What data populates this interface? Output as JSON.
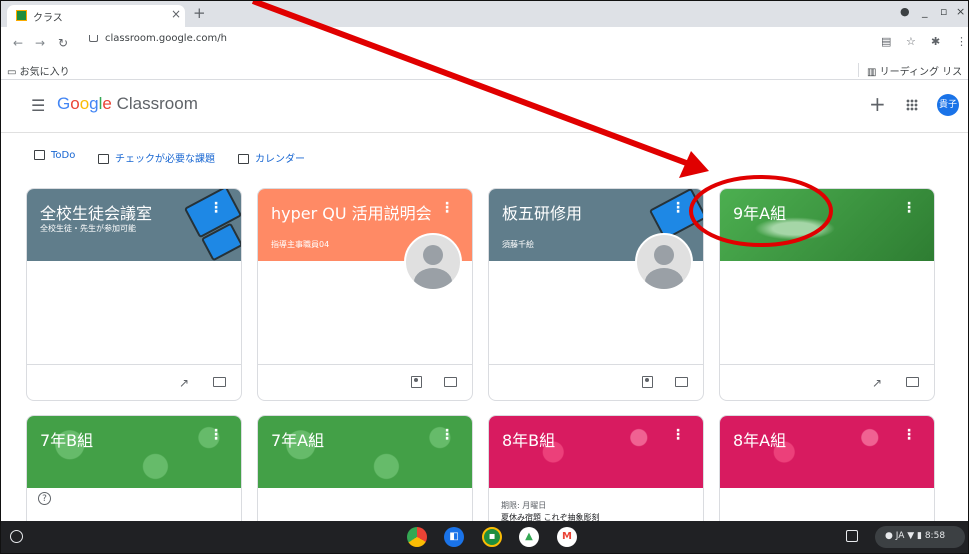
{
  "browser": {
    "tab_title": "クラス",
    "tab_close": "×",
    "new_tab": "+",
    "url": "classroom.google.com/h",
    "bookmark_folder": "お気に入り",
    "reading_list": "リーディング リスト"
  },
  "header": {
    "brand_google": "Google",
    "brand_classroom": " Classroom",
    "plus": "+",
    "avatar_text": "貴子"
  },
  "subbar": {
    "todo": "ToDo",
    "review": "チェックが必要な課題",
    "calendar": "カレンダー"
  },
  "cards": [
    {
      "title": "全校生徒会議室",
      "subtitle": "全校生徒・先生が参加可能",
      "teacher": "",
      "color": "#607d8b"
    },
    {
      "title": "hyper QU 活用説明会",
      "subtitle": "",
      "teacher": "指導主事職員04",
      "color": "#ff8a65"
    },
    {
      "title": "板五研修用",
      "subtitle": "",
      "teacher": "須藤千絵",
      "color": "#607d8b"
    },
    {
      "title": "9年A組",
      "subtitle": "",
      "teacher": "",
      "color": "#43a047"
    },
    {
      "title": "7年B組",
      "subtitle": "",
      "teacher": "",
      "color": "#43a047"
    },
    {
      "title": "7年A組",
      "subtitle": "",
      "teacher": "",
      "color": "#43a047"
    },
    {
      "title": "8年B組",
      "subtitle": "",
      "teacher": "",
      "color": "#d81b60",
      "due_label": "期限: 月曜日",
      "due_item": "夏休み宿題 これぞ抽象彫刻"
    },
    {
      "title": "8年A組",
      "subtitle": "",
      "teacher": "",
      "color": "#d81b60"
    }
  ],
  "shelf": {
    "apps": [
      "chrome-icon",
      "files-icon",
      "classroom-icon",
      "drive-icon",
      "gmail-icon"
    ],
    "status": "JA ▼ ▮ 8:58"
  },
  "annotation": {
    "color": "#e00000"
  }
}
